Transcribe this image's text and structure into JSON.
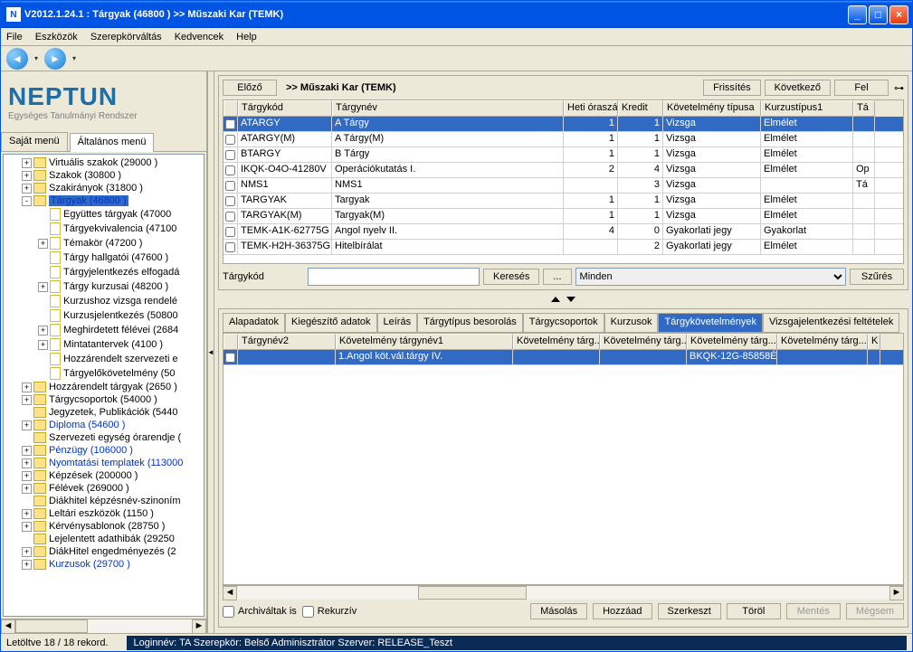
{
  "title": "V2012.1.24.1 : Tárgyak (46800  )   >> Műszaki Kar (TEMK)",
  "menu": {
    "file": "File",
    "tools": "Eszközök",
    "role": "Szerepkörváltás",
    "fav": "Kedvencek",
    "help": "Help"
  },
  "logo": {
    "text": "NEPTUN",
    "sub": "Egységes Tanulmányi Rendszer"
  },
  "left_tabs": {
    "own": "Saját menü",
    "general": "Általános menü"
  },
  "tree": [
    {
      "lvl": 1,
      "exp": "+",
      "icon": "y",
      "label": "Virtuális szakok (29000  )"
    },
    {
      "lvl": 1,
      "exp": "+",
      "icon": "y",
      "label": "Szakok (30800  )"
    },
    {
      "lvl": 1,
      "exp": "+",
      "icon": "y",
      "label": "Szakirányok (31800  )"
    },
    {
      "lvl": 1,
      "exp": "-",
      "icon": "y",
      "label": "Tárgyak (46800  )",
      "sel": true,
      "blue": true
    },
    {
      "lvl": 2,
      "exp": "",
      "icon": "d",
      "label": "Együttes tárgyak (47000"
    },
    {
      "lvl": 2,
      "exp": "",
      "icon": "d",
      "label": "Tárgyekvivalencia (47100"
    },
    {
      "lvl": 2,
      "exp": "+",
      "icon": "d",
      "label": "Témakör (47200  )"
    },
    {
      "lvl": 2,
      "exp": "",
      "icon": "d",
      "label": "Tárgy hallgatói (47600  )"
    },
    {
      "lvl": 2,
      "exp": "",
      "icon": "d",
      "label": "Tárgyjelentkezés elfogadá"
    },
    {
      "lvl": 2,
      "exp": "+",
      "icon": "d",
      "label": "Tárgy kurzusai (48200  )"
    },
    {
      "lvl": 2,
      "exp": "",
      "icon": "d",
      "label": "Kurzushoz vizsga rendelé"
    },
    {
      "lvl": 2,
      "exp": "",
      "icon": "d",
      "label": "Kurzusjelentkezés (50800"
    },
    {
      "lvl": 2,
      "exp": "+",
      "icon": "d",
      "label": "Meghirdetett félévei (2684"
    },
    {
      "lvl": 2,
      "exp": "+",
      "icon": "d",
      "label": "Mintatantervek (4100  )"
    },
    {
      "lvl": 2,
      "exp": "",
      "icon": "d",
      "label": "Hozzárendelt szervezeti e"
    },
    {
      "lvl": 2,
      "exp": "",
      "icon": "d",
      "label": "Tárgyelőkövetelmény (50"
    },
    {
      "lvl": 1,
      "exp": "+",
      "icon": "y",
      "label": "Hozzárendelt tárgyak (2650  )"
    },
    {
      "lvl": 1,
      "exp": "+",
      "icon": "y",
      "label": "Tárgycsoportok (54000  )"
    },
    {
      "lvl": 1,
      "exp": "",
      "icon": "y",
      "label": "Jegyzetek, Publikációk (5440"
    },
    {
      "lvl": 1,
      "exp": "+",
      "icon": "y",
      "label": "Diploma (54600  )",
      "blue": true
    },
    {
      "lvl": 1,
      "exp": "",
      "icon": "y",
      "label": "Szervezeti egység órarendje ("
    },
    {
      "lvl": 1,
      "exp": "+",
      "icon": "y",
      "label": "Pénzügy (106000  )",
      "blue": true
    },
    {
      "lvl": 1,
      "exp": "+",
      "icon": "y",
      "label": "Nyomtatási templatek (113000",
      "blue": true
    },
    {
      "lvl": 1,
      "exp": "+",
      "icon": "y",
      "label": "Képzések (200000  )"
    },
    {
      "lvl": 1,
      "exp": "+",
      "icon": "y",
      "label": "Félévek (269000  )"
    },
    {
      "lvl": 1,
      "exp": "",
      "icon": "y",
      "label": "Diákhitel képzésnév-szinoním"
    },
    {
      "lvl": 1,
      "exp": "+",
      "icon": "y",
      "label": "Leltári eszközök (1150  )"
    },
    {
      "lvl": 1,
      "exp": "+",
      "icon": "y",
      "label": "Kérvénysablonok (28750  )"
    },
    {
      "lvl": 1,
      "exp": "",
      "icon": "y",
      "label": "Lejelentett adathibák (29250"
    },
    {
      "lvl": 1,
      "exp": "+",
      "icon": "y",
      "label": "DiákHitel engedményezés (2"
    },
    {
      "lvl": 1,
      "exp": "+",
      "icon": "y",
      "label": "Kurzusok (29700  )",
      "blue": true
    }
  ],
  "top": {
    "prev": "Előző",
    "crumb": ">>  Műszaki Kar (TEMK)",
    "refresh": "Frissítés",
    "next": "Következő",
    "up": "Fel"
  },
  "grid1": {
    "cols": [
      "Tárgykód",
      "Tárgynév",
      "Heti óraszá...",
      "Kredit",
      "Követelmény típusa",
      "Kurzustípus1",
      "Tá"
    ],
    "widths": [
      104,
      256,
      60,
      50,
      108,
      102,
      24
    ],
    "rows": [
      {
        "sel": true,
        "c": [
          "ATARGY",
          "A Tárgy",
          "1",
          "1",
          "Vizsga",
          "Elmélet",
          ""
        ]
      },
      {
        "c": [
          "ATARGY(M)",
          "A Tárgy(M)",
          "1",
          "1",
          "Vizsga",
          "Elmélet",
          ""
        ]
      },
      {
        "c": [
          "BTARGY",
          "B Tárgy",
          "1",
          "1",
          "Vizsga",
          "Elmélet",
          ""
        ]
      },
      {
        "c": [
          "IKQK-O4O-41280V",
          "Operációkutatás I.",
          "2",
          "4",
          "Vizsga",
          "Elmélet",
          "Op"
        ]
      },
      {
        "c": [
          "NMS1",
          "NMS1",
          "",
          "3",
          "Vizsga",
          "",
          "Tá"
        ]
      },
      {
        "c": [
          "TARGYAK",
          "Targyak",
          "1",
          "1",
          "Vizsga",
          "Elmélet",
          ""
        ]
      },
      {
        "c": [
          "TARGYAK(M)",
          "Targyak(M)",
          "1",
          "1",
          "Vizsga",
          "Elmélet",
          ""
        ]
      },
      {
        "c": [
          "TEMK-A1K-62775G",
          "Angol nyelv II.",
          "4",
          "0",
          "Gyakorlati jegy",
          "Gyakorlat",
          ""
        ]
      },
      {
        "c": [
          "TEMK-H2H-36375G",
          "Hitelbírálat",
          "",
          "2",
          "Gyakorlati jegy",
          "Elmélet",
          ""
        ]
      }
    ]
  },
  "search": {
    "label": "Tárgykód",
    "btn": "Keresés",
    "dots": "...",
    "sel": "Minden",
    "filter": "Szűrés"
  },
  "tabs2": [
    "Alapadatok",
    "Kiegészítő adatok",
    "Leírás",
    "Tárgytípus besorolás",
    "Tárgycsoportok",
    "Kurzusok",
    "Tárgykövetelmények",
    "Vizsgajelentkezési feltételek"
  ],
  "tabs2_active": 6,
  "grid2": {
    "cols": [
      "Tárgynév2",
      "Követelmény tárgynév1",
      "Követelmény tárg...",
      "Követelmény tárg...",
      "Követelmény tárg...",
      "Követelmény tárg...",
      "K"
    ],
    "widths": [
      108,
      196,
      96,
      96,
      100,
      100,
      14
    ],
    "rows": [
      {
        "sel": true,
        "c": [
          "",
          "1.Angol köt.vál.tárgy IV.",
          "",
          "",
          "BKQK-12G-85858É",
          "",
          ""
        ]
      }
    ]
  },
  "checks": {
    "archived": "Archiváltak is",
    "recursive": "Rekurzív"
  },
  "buttons": {
    "copy": "Másolás",
    "add": "Hozzáad",
    "edit": "Szerkeszt",
    "del": "Töröl",
    "save": "Mentés",
    "cancel": "Mégsem"
  },
  "status": {
    "records": "Letöltve 18 / 18 rekord.",
    "login": "Loginnév: TA  Szerepkör: Belső Adminisztrátor  Szerver: RELEASE_Teszt"
  }
}
